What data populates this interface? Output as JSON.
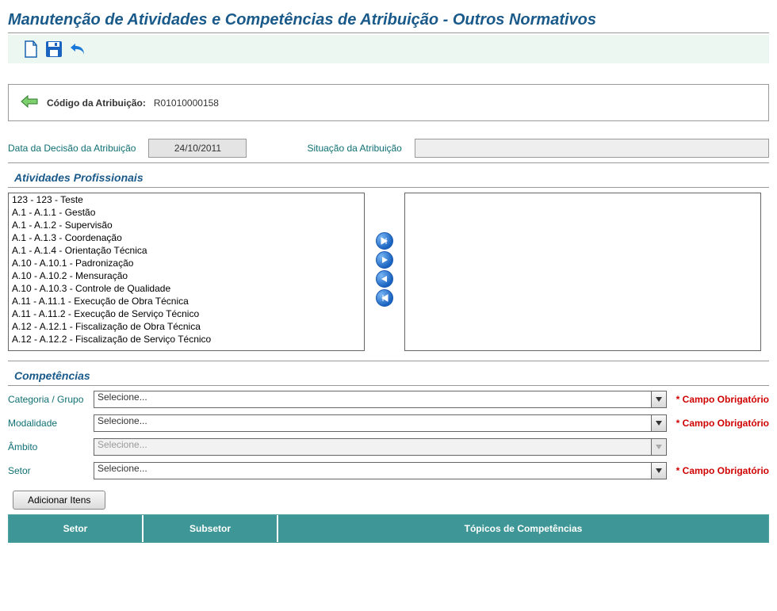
{
  "page_title": "Manutenção de Atividades e Competências de Atribuição - Outros Normativos",
  "code": {
    "label": "Código da Atribuição:",
    "value": "R01010000158"
  },
  "decision_date": {
    "label": "Data da Decisão da Atribuição",
    "value": "24/10/2011"
  },
  "situation": {
    "label": "Situação da Atribuição",
    "value": ""
  },
  "sections": {
    "activities": "Atividades Profissionais",
    "competencies": "Competências"
  },
  "activities_available": [
    "123 - 123 - Teste",
    "A.1 - A.1.1 - Gestão",
    "A.1 - A.1.2 - Supervisão",
    "A.1 - A.1.3 - Coordenação",
    "A.1 - A.1.4 - Orientação Técnica",
    "A.10 - A.10.1 - Padronização",
    "A.10 - A.10.2 - Mensuração",
    "A.10 - A.10.3 - Controle de Qualidade",
    "A.11 - A.11.1 - Execução de Obra Técnica",
    "A.11 - A.11.2 - Execução de Serviço Técnico",
    "A.12 - A.12.1 - Fiscalização de Obra Técnica",
    "A.12 - A.12.2 - Fiscalização de Serviço Técnico"
  ],
  "competency_form": {
    "categoria": {
      "label": "Categoria / Grupo",
      "value": "Selecione...",
      "required": "* Campo Obrigatório"
    },
    "modalidade": {
      "label": "Modalidade",
      "value": "Selecione...",
      "required": "* Campo Obrigatório"
    },
    "ambito": {
      "label": "Âmbito",
      "value": "Selecione..."
    },
    "setor": {
      "label": "Setor",
      "value": "Selecione...",
      "required": "* Campo Obrigatório"
    }
  },
  "add_button": "Adicionar Itens",
  "table_headers": {
    "setor": "Setor",
    "subsetor": "Subsetor",
    "topicos": "Tópicos de Competências"
  }
}
